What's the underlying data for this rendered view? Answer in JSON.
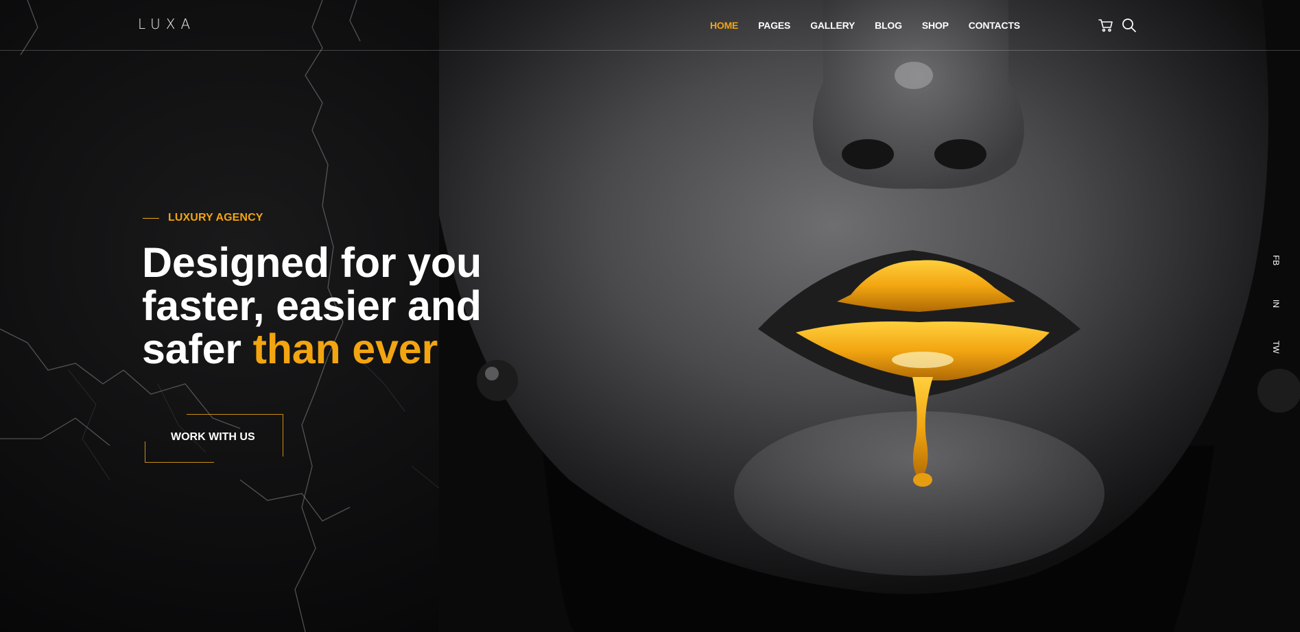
{
  "brand": {
    "logo": "LUXA",
    "accent_color": "#f2a511"
  },
  "nav": {
    "items": [
      {
        "label": "HOME",
        "active": true
      },
      {
        "label": "PAGES",
        "active": false
      },
      {
        "label": "GALLERY",
        "active": false
      },
      {
        "label": "BLOG",
        "active": false
      },
      {
        "label": "SHOP",
        "active": false
      },
      {
        "label": "CONTACTS",
        "active": false
      }
    ],
    "icons": [
      "cart-icon",
      "search-icon"
    ]
  },
  "hero": {
    "eyebrow": "LUXURY AGENCY",
    "headline_line1": "Designed for you",
    "headline_line2": "faster, easier and",
    "headline_line3_plain": "safer ",
    "headline_line3_accent": "than ever",
    "cta_label": "WORK WITH US"
  },
  "social": {
    "items": [
      "FB",
      "IN",
      "TW"
    ]
  }
}
